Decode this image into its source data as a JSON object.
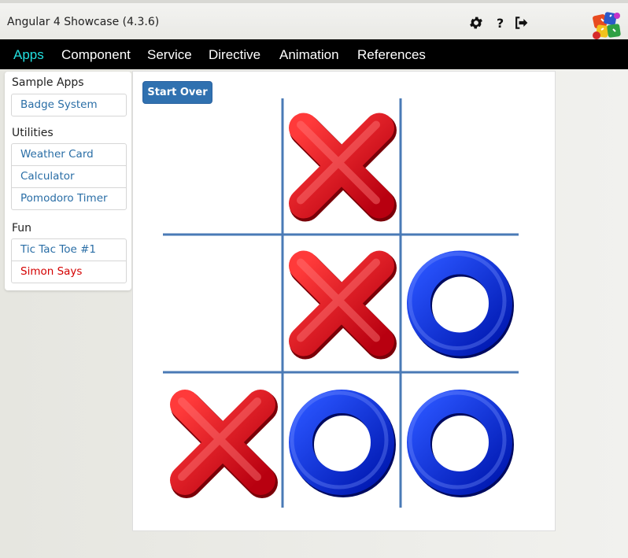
{
  "header": {
    "title": "Angular 4 Showcase (4.3.6)",
    "icons": [
      "gear-icon",
      "help-icon",
      "logout-icon"
    ]
  },
  "nav": {
    "items": [
      "Apps",
      "Component",
      "Service",
      "Directive",
      "Animation",
      "References"
    ],
    "active": "Apps",
    "active_color": "#22e0e0"
  },
  "sidebar": {
    "sections": [
      {
        "title": "Sample Apps",
        "items": [
          "Badge System"
        ]
      },
      {
        "title": "Utilities",
        "items": [
          "Weather Card",
          "Calculator",
          "Pomodoro Timer"
        ]
      },
      {
        "title": "Fun",
        "items": [
          "Tic Tac Toe #1",
          "Simon Says"
        ]
      }
    ],
    "highlighted_item": "Simon Says",
    "highlight_color": "#d40000"
  },
  "game": {
    "start_over_label": "Start Over",
    "board": [
      [
        "",
        "X",
        ""
      ],
      [
        "",
        "X",
        "O"
      ],
      [
        "X",
        "O",
        "O"
      ]
    ],
    "colors": {
      "x": "#e8141c",
      "o": "#0a2ee0",
      "grid": "#4a7ab6"
    }
  }
}
